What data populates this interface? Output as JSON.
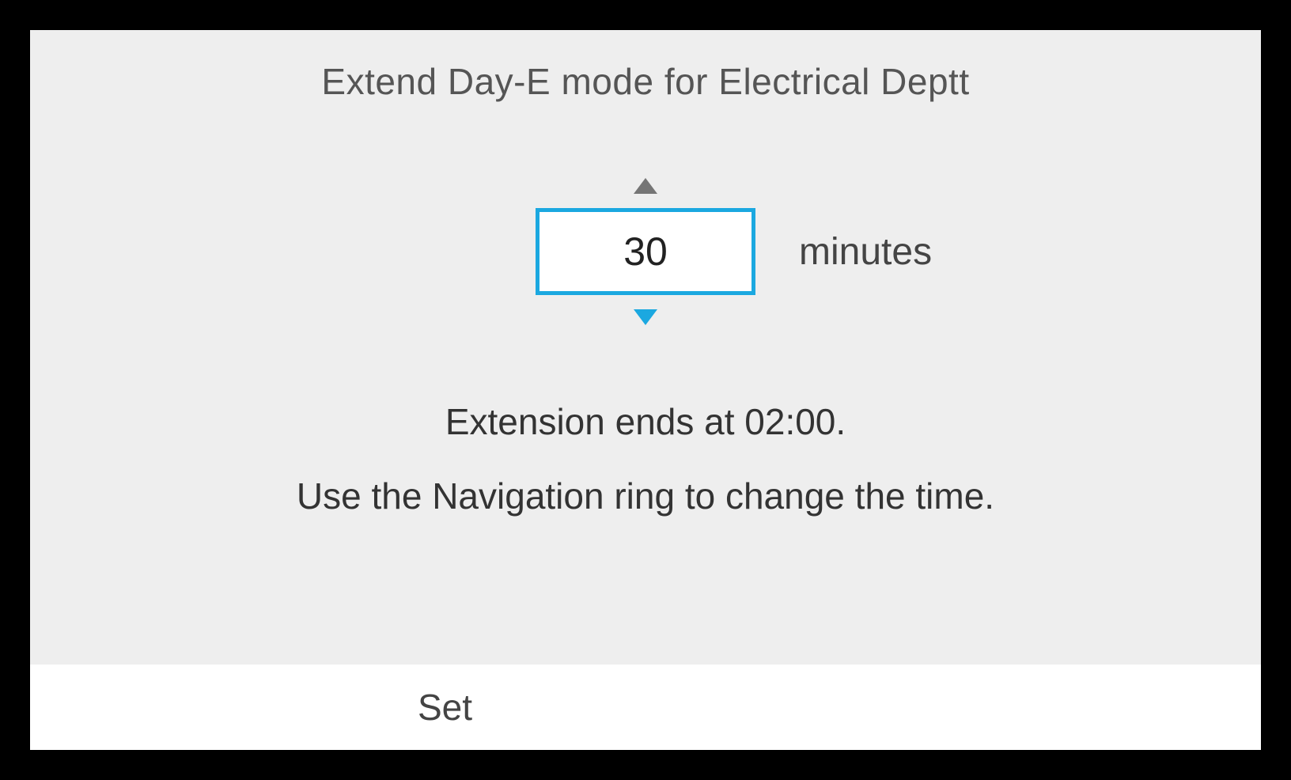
{
  "title": "Extend Day-E mode for Electrical Deptt",
  "stepper": {
    "value": "30",
    "unit": "minutes"
  },
  "info": {
    "line1": "Extension ends at 02:00.",
    "line2": "Use the Navigation ring to change the time."
  },
  "button": {
    "set": "Set"
  }
}
